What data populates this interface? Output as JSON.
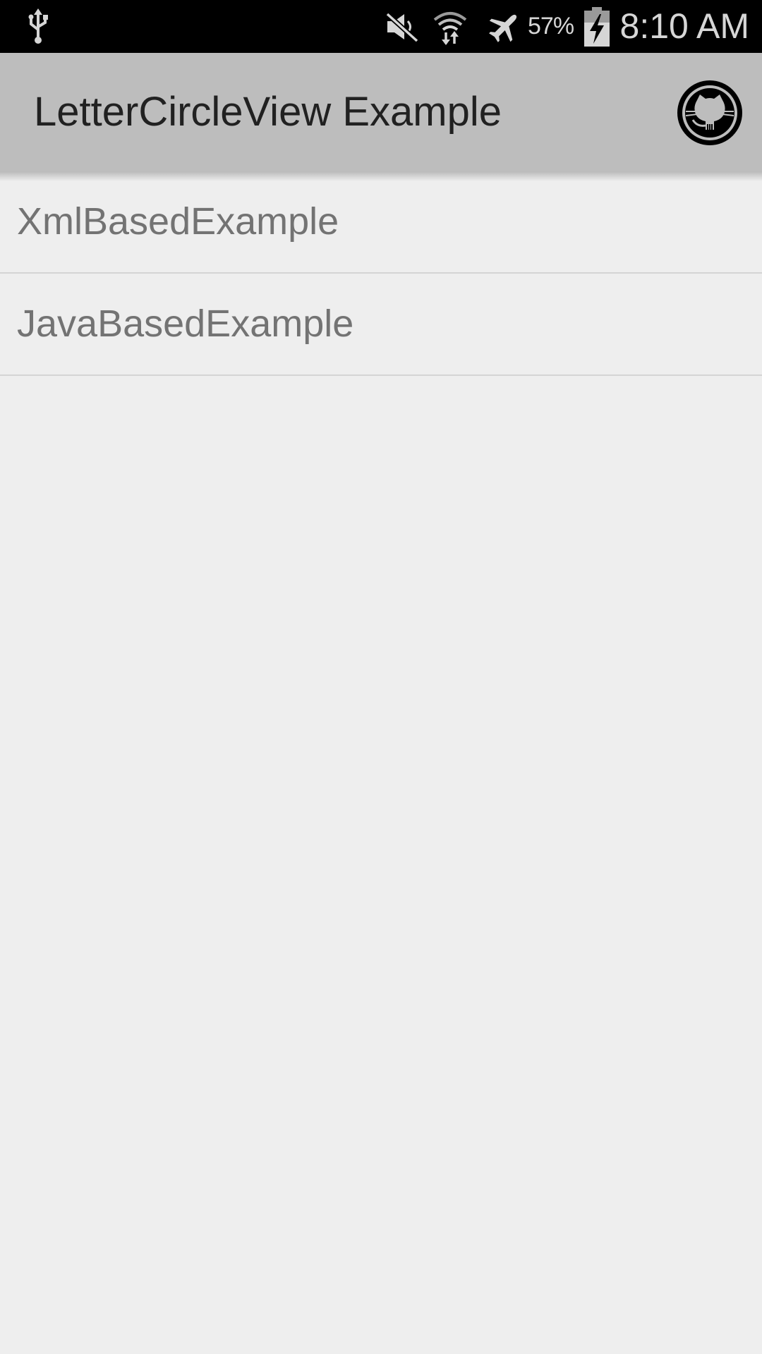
{
  "status_bar": {
    "battery_percent": "57%",
    "time": "8:10 AM",
    "icons": [
      "usb-icon",
      "mute-icon",
      "wifi-icon",
      "airplane-icon",
      "battery-charging-icon"
    ]
  },
  "action_bar": {
    "title": "LetterCircleView Example",
    "github_icon": "github-octocat-icon"
  },
  "list": {
    "items": [
      {
        "label": "XmlBasedExample"
      },
      {
        "label": "JavaBasedExample"
      }
    ]
  },
  "colors": {
    "status_bar_bg": "#000000",
    "action_bar_bg": "#bdbdbd",
    "background": "#eeeeee",
    "item_text": "#737373",
    "divider": "#d4d4d4"
  }
}
